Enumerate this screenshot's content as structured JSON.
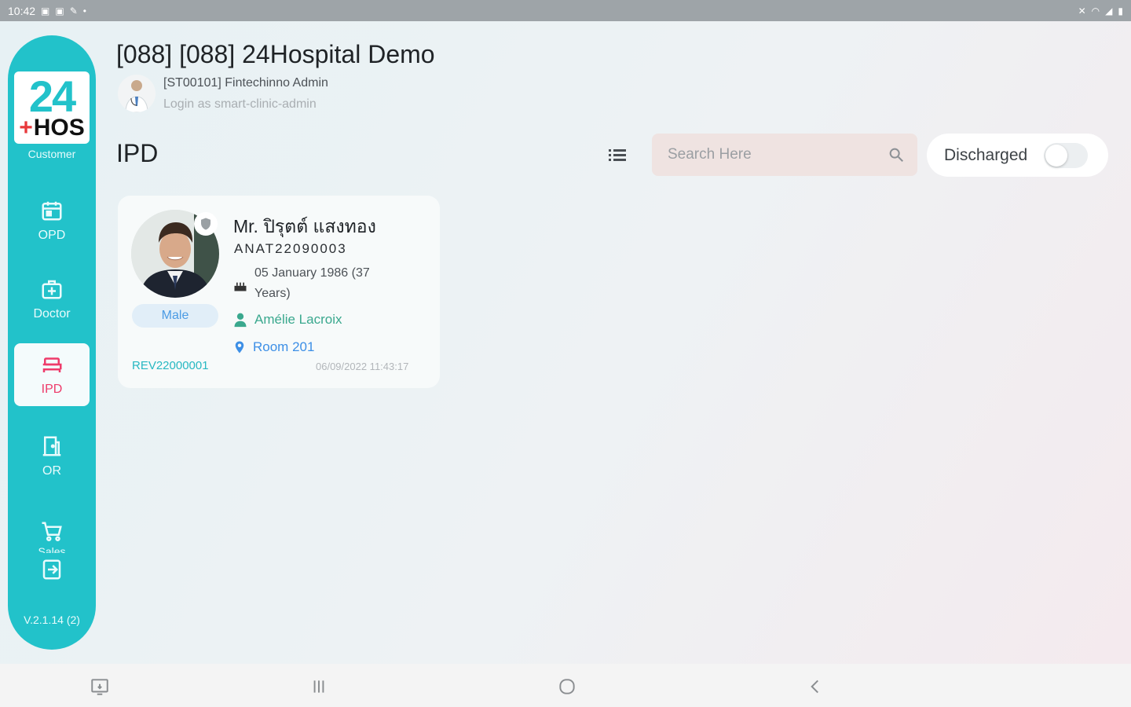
{
  "status_bar": {
    "time": "10:42",
    "icons_left": [
      "image-icon",
      "image-icon",
      "edit-icon",
      "dot-icon"
    ],
    "icons_right": [
      "mute-icon",
      "wifi-icon",
      "signal-icon",
      "battery-icon"
    ]
  },
  "sidebar": {
    "logo": {
      "top": "24",
      "bottom": "HOS",
      "plus": "+"
    },
    "customer_label": "Customer",
    "items": [
      {
        "label": "OPD",
        "icon": "calendar-icon",
        "active": false
      },
      {
        "label": "Doctor",
        "icon": "medical-bag-icon",
        "active": false
      },
      {
        "label": "IPD",
        "icon": "bed-icon",
        "active": true
      },
      {
        "label": "OR",
        "icon": "door-icon",
        "active": false
      },
      {
        "label": "Sales",
        "icon": "cart-icon",
        "active": false
      }
    ],
    "logout_icon": "logout-icon",
    "version": "V.2.1.14 (2)"
  },
  "header": {
    "hospital_title": "[088] [088] 24Hospital Demo",
    "user_name": "[ST00101] Fintechinno Admin",
    "login_as": "Login as smart-clinic-admin"
  },
  "section": {
    "title": "IPD",
    "search_placeholder": "Search Here",
    "discharged_label": "Discharged",
    "discharged_on": false
  },
  "patient_card": {
    "name": "Mr. ปิรุตต์ แสงทอง",
    "patient_id": "ANAT22090003",
    "dob": "05 January 1986 (37 Years)",
    "gender": "Male",
    "doctor": "Amélie Lacroix",
    "room": "Room 201",
    "rev_code": "REV22000001",
    "timestamp": "06/09/2022 11:43:17"
  },
  "colors": {
    "brand": "#22c2ca",
    "active_nav": "#ee3b6a",
    "doctor_green": "#3aa88e",
    "room_blue": "#3d8fe6"
  }
}
